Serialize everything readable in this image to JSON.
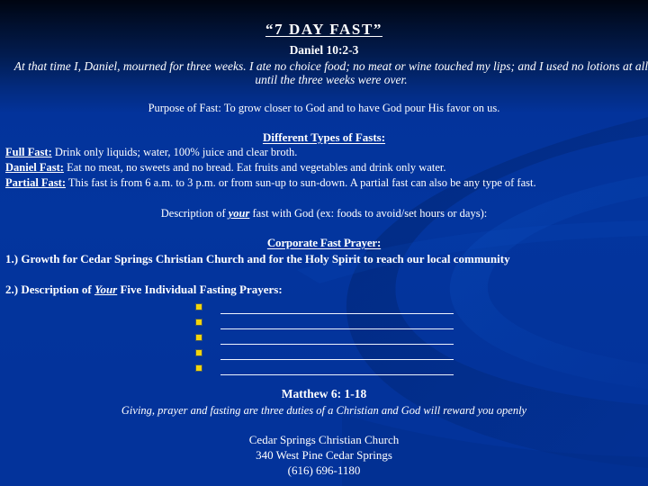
{
  "slide": {
    "background_top_color": "#000511",
    "background_bottom_color": "#03339b",
    "bullet_color": "#f2d40c",
    "text_color": "#ffffff",
    "title": "“7 DAY FAST”",
    "subtitle": "Daniel 10:2-3",
    "scripture": "At that time I, Daniel, mourned for three weeks. I ate no choice food; no meat or wine touched my lips; and I used no lotions at all until the three weeks were over.",
    "purpose": "Purpose of Fast:  To grow closer to God and to have God pour His favor on us.",
    "types_heading": "Different Types of Fasts:",
    "fasts": [
      {
        "label": "Full Fast:",
        "text": "    Drink only liquids; water, 100% juice and clear broth."
      },
      {
        "label": "Daniel Fast:",
        "text": " Eat no meat, no sweets and no bread. Eat fruits and vegetables and drink only water."
      },
      {
        "label": "Partial Fast:",
        "text": " This fast is from 6 a.m. to 3 p.m. or from sun-up to sun-down. A partial fast can also be any type of fast."
      }
    ],
    "description_prompt": {
      "before": "Description of ",
      "emphasis": "your",
      "after": " fast with God (ex:  foods to avoid/set hours or days):"
    },
    "corporate_heading": "Corporate Fast Prayer:",
    "prayer_one": "1.) Growth for Cedar Springs Christian Church and for the Holy Spirit to reach our local community",
    "prayer_two": {
      "before": "2.) Description of ",
      "emphasis": "Your",
      "after": "  Five Individual Fasting Prayers:"
    },
    "blank_lines": [
      "",
      "",
      "",
      "",
      ""
    ],
    "verse_reference": "Matthew 6: 1-18",
    "verse_text": "Giving, prayer and fasting are three duties of a Christian and God will reward you openly",
    "footer": {
      "church": "Cedar Springs Christian Church",
      "address": "340 West Pine Cedar Springs",
      "phone": "(616) 696-1180"
    }
  }
}
